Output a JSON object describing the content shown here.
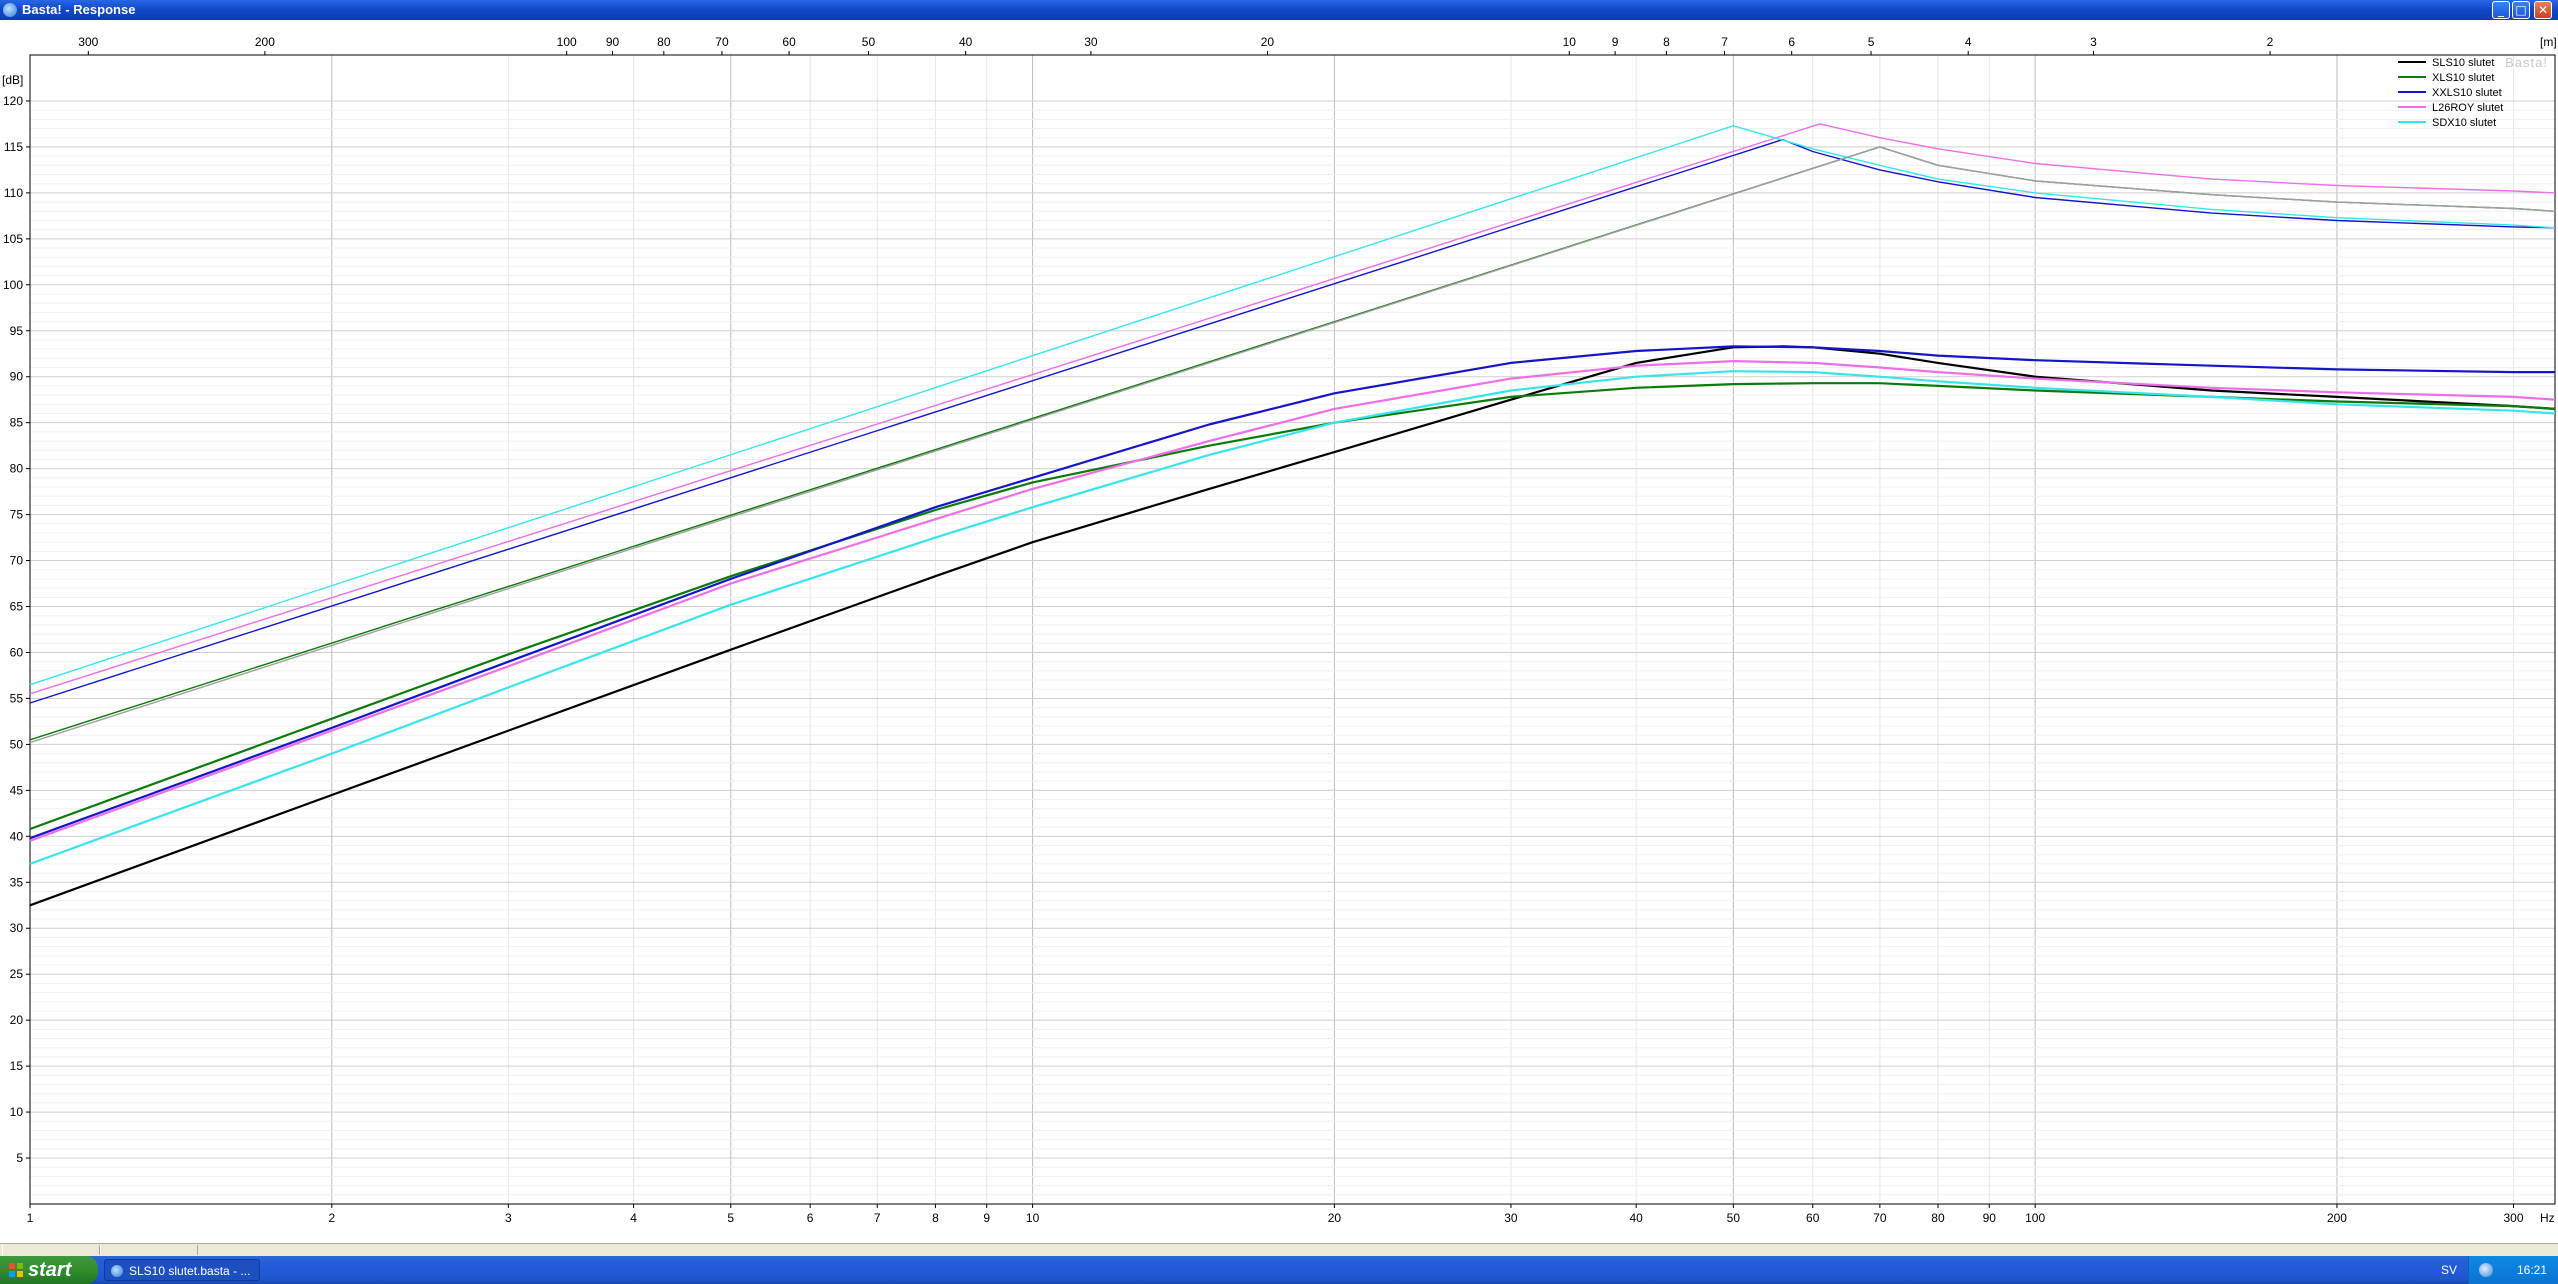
{
  "window": {
    "title": "Basta! - Response",
    "controls": {
      "minimize": "_",
      "maximize": "□",
      "close": "✕"
    }
  },
  "taskbar": {
    "start_label": "start",
    "task_label": "SLS10 slutet.basta - ...",
    "language": "SV",
    "clock": "16:21"
  },
  "colors": {
    "SLS10": "#000000",
    "XLS10": "#0a7a0a",
    "XXLS10": "#1414c8",
    "L26ROY": "#ee6ee8",
    "SDX10": "#38e4ec",
    "grid": "#c8c8c8"
  },
  "chart_data": {
    "type": "line",
    "title": "",
    "watermark": "Basta!",
    "xlabel": "Hz",
    "ylabel": "[dB]",
    "x2label": "[m]",
    "xscale": "log",
    "xlim": [
      1,
      330
    ],
    "ylim": [
      0,
      125
    ],
    "grid": true,
    "legend_position": "top-right",
    "x_ticks": [
      "1",
      "2",
      "3",
      "4",
      "5",
      "6",
      "7",
      "8",
      "9",
      "10",
      "20",
      "30",
      "40",
      "50",
      "60",
      "70",
      "80",
      "90",
      "100",
      "200",
      "300"
    ],
    "y_ticks": [
      "5",
      "10",
      "15",
      "20",
      "25",
      "30",
      "35",
      "40",
      "45",
      "50",
      "55",
      "60",
      "65",
      "70",
      "75",
      "80",
      "85",
      "90",
      "95",
      "100",
      "105",
      "110",
      "115",
      "120"
    ],
    "wavelength_ticks": [
      "300",
      "200",
      "100",
      "90",
      "80",
      "70",
      "60",
      "50",
      "40",
      "30",
      "20",
      "10",
      "9",
      "8",
      "7",
      "6",
      "5",
      "4",
      "3",
      "2"
    ],
    "series": [
      {
        "name": "SLS10 slutet",
        "color": "#000000",
        "x": [
          1,
          2,
          3,
          5,
          8,
          10,
          15,
          20,
          30,
          40,
          50,
          56,
          60,
          70,
          80,
          100,
          150,
          200,
          300,
          330
        ],
        "y": [
          32.5,
          44.5,
          51.5,
          60.3,
          68.3,
          72.0,
          77.8,
          81.8,
          87.5,
          91.5,
          93.2,
          93.3,
          93.2,
          92.5,
          91.5,
          90.0,
          88.5,
          87.8,
          86.8,
          86.5
        ]
      },
      {
        "name": "XLS10 slutet",
        "color": "#0a7a0a",
        "x": [
          1,
          2,
          3,
          5,
          8,
          10,
          15,
          20,
          30,
          40,
          50,
          60,
          70,
          80,
          100,
          150,
          200,
          300,
          330
        ],
        "y": [
          40.8,
          52.8,
          59.8,
          68.3,
          75.5,
          78.5,
          82.5,
          85.0,
          87.8,
          88.8,
          89.2,
          89.3,
          89.3,
          89.0,
          88.5,
          87.8,
          87.3,
          86.8,
          86.5
        ]
      },
      {
        "name": "XXLS10 slutet",
        "color": "#1414c8",
        "x": [
          1,
          2,
          3,
          5,
          8,
          10,
          15,
          20,
          30,
          40,
          50,
          60,
          70,
          80,
          100,
          150,
          200,
          300,
          330
        ],
        "y": [
          39.8,
          51.8,
          59.0,
          68.0,
          75.8,
          79.0,
          84.8,
          88.2,
          91.5,
          92.8,
          93.3,
          93.2,
          92.8,
          92.3,
          91.8,
          91.2,
          90.8,
          90.5,
          90.5
        ]
      },
      {
        "name": "L26ROY slutet",
        "color": "#ee6ee8",
        "x": [
          1,
          2,
          3,
          5,
          8,
          10,
          15,
          20,
          30,
          40,
          50,
          60,
          70,
          80,
          100,
          150,
          200,
          300,
          330
        ],
        "y": [
          39.5,
          51.5,
          58.5,
          67.5,
          74.5,
          77.8,
          83.0,
          86.5,
          89.8,
          91.2,
          91.7,
          91.5,
          91.0,
          90.5,
          89.8,
          88.8,
          88.3,
          87.8,
          87.5
        ]
      },
      {
        "name": "SDX10 slutet",
        "color": "#38e4ec",
        "x": [
          1,
          2,
          3,
          5,
          8,
          10,
          15,
          20,
          30,
          40,
          50,
          60,
          70,
          80,
          100,
          150,
          200,
          300,
          330
        ],
        "y": [
          37.0,
          49.0,
          56.2,
          65.2,
          72.5,
          75.8,
          81.5,
          85.0,
          88.5,
          90.0,
          90.6,
          90.5,
          90.0,
          89.5,
          88.8,
          87.8,
          87.0,
          86.3,
          86.0
        ]
      }
    ],
    "upper_curves": [
      {
        "color": "#1414c8",
        "x": [
          1,
          56,
          60,
          70,
          80,
          100,
          150,
          200,
          300,
          330
        ],
        "y": [
          54.5,
          115.8,
          114.5,
          112.5,
          111.2,
          109.5,
          107.8,
          107.0,
          106.3,
          106.2
        ]
      },
      {
        "color": "#ee6ee8",
        "x": [
          1,
          61,
          70,
          80,
          100,
          150,
          200,
          300,
          330
        ],
        "y": [
          55.5,
          117.5,
          116.0,
          114.8,
          113.2,
          111.5,
          110.8,
          110.2,
          110.0
        ]
      },
      {
        "color": "#38e4ec",
        "x": [
          1,
          50,
          60,
          70,
          80,
          100,
          150,
          200,
          300,
          330
        ],
        "y": [
          56.5,
          117.3,
          114.8,
          113.0,
          111.5,
          110.0,
          108.2,
          107.3,
          106.5,
          106.2
        ]
      },
      {
        "color": "#0a7a0a",
        "x": [
          1,
          70,
          80,
          100,
          150,
          200,
          300,
          330
        ],
        "y": [
          50.5,
          115.0,
          113.0,
          111.3,
          109.8,
          109.0,
          108.3,
          108.0
        ]
      },
      {
        "color": "#a0a0a0",
        "x": [
          1,
          70,
          80,
          100,
          150,
          200,
          300,
          330
        ],
        "y": [
          50.2,
          115.0,
          113.0,
          111.3,
          109.8,
          109.0,
          108.3,
          108.0
        ]
      }
    ]
  }
}
